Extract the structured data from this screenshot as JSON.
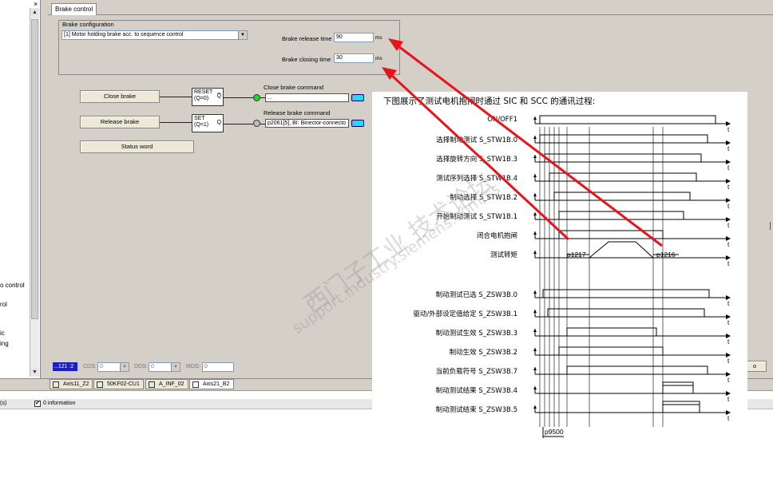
{
  "left_panel": {
    "close_x": "×",
    "items": [
      "o control",
      "rol",
      "ic",
      "ing"
    ]
  },
  "tab": {
    "label": "Brake control"
  },
  "brake_config": {
    "group_title": "Brake  configuration",
    "combo_value": "[1] Motor holding brake acc. to sequence control",
    "release_time_label": "Brake release time",
    "release_time_value": "90",
    "release_time_unit": "ms",
    "closing_time_label": "Brake closing time",
    "closing_time_value": "30",
    "closing_time_unit": "ms"
  },
  "logic": {
    "close_brake_btn": "Close brake",
    "release_brake_btn": "Release brake",
    "status_word_btn": "Status word",
    "reset_gate_line1": "RESET",
    "reset_gate_line2": "(Q=0)",
    "reset_gate_out": "Q̅",
    "set_gate_line1": "SET",
    "set_gate_line2": "(Q=1)",
    "set_gate_out": "Q",
    "close_cmd_label": "Close brake command",
    "close_cmd_value": "...",
    "release_cmd_label": "Release brake command",
    "release_cmd_value": "p2061[5], BI: Binector-connecto"
  },
  "status_bar": {
    "index": "...121 :2",
    "cds_label": "CDS:",
    "cds_value": "0",
    "dds_label": "DDS:",
    "dds_value": "0",
    "mds_label": "MDS:",
    "mds_value": "0",
    "right_btn": "o"
  },
  "bottom_tabs": [
    "Axis11_Z2",
    "50KF02-CU1",
    "A_INF_02",
    "Axis21_B2"
  ],
  "info_strip": {
    "left_text": "(s)",
    "checkbox_label": "0 information",
    "checked": true
  },
  "overlay": {
    "title": "下图展示了测试电机抱闸时通过 SIC 和 SCC 的通讯过程:",
    "rows": [
      {
        "cn": "ON/OFF1",
        "sig": ""
      },
      {
        "cn": "选择制动测试",
        "sig": "S_STW1B.0"
      },
      {
        "cn": "选择旋转方向",
        "sig": "S_STW1B.3"
      },
      {
        "cn": "测试序列选择",
        "sig": "S_STW1B.4"
      },
      {
        "cn": "制动选择",
        "sig": "S_STW1B.2"
      },
      {
        "cn": "开始制动测试",
        "sig": "S_STW1B.1"
      },
      {
        "cn": "闭合电机抱闸",
        "sig": ""
      },
      {
        "cn": "测试转矩",
        "sig": ""
      },
      {
        "cn": "制动测试已选",
        "sig": "S_ZSW3B.0"
      },
      {
        "cn": "驱动/外部设定值给定",
        "sig": "S_ZSW3B.1"
      },
      {
        "cn": "制动测试生效",
        "sig": "S_ZSW3B.3"
      },
      {
        "cn": "制动生效",
        "sig": "S_ZSW3B.2"
      },
      {
        "cn": "当前负载符号",
        "sig": "S_ZSW3B.7"
      },
      {
        "cn": "制动测试结果",
        "sig": "S_ZSW3B.4"
      },
      {
        "cn": "制动测试结束",
        "sig": "S_ZSW3B.5"
      }
    ],
    "t_label": "t",
    "p1217": "p1217",
    "p1216": "p1216",
    "p9500": "p9500",
    "watermark_cn": "西门子工业  技术论坛",
    "watermark_en": "support.industry.siemens.com/cs"
  },
  "colors": {
    "arrow": "#e8141c",
    "led_on": "#22d422",
    "cyan": "#2ad7ee"
  }
}
